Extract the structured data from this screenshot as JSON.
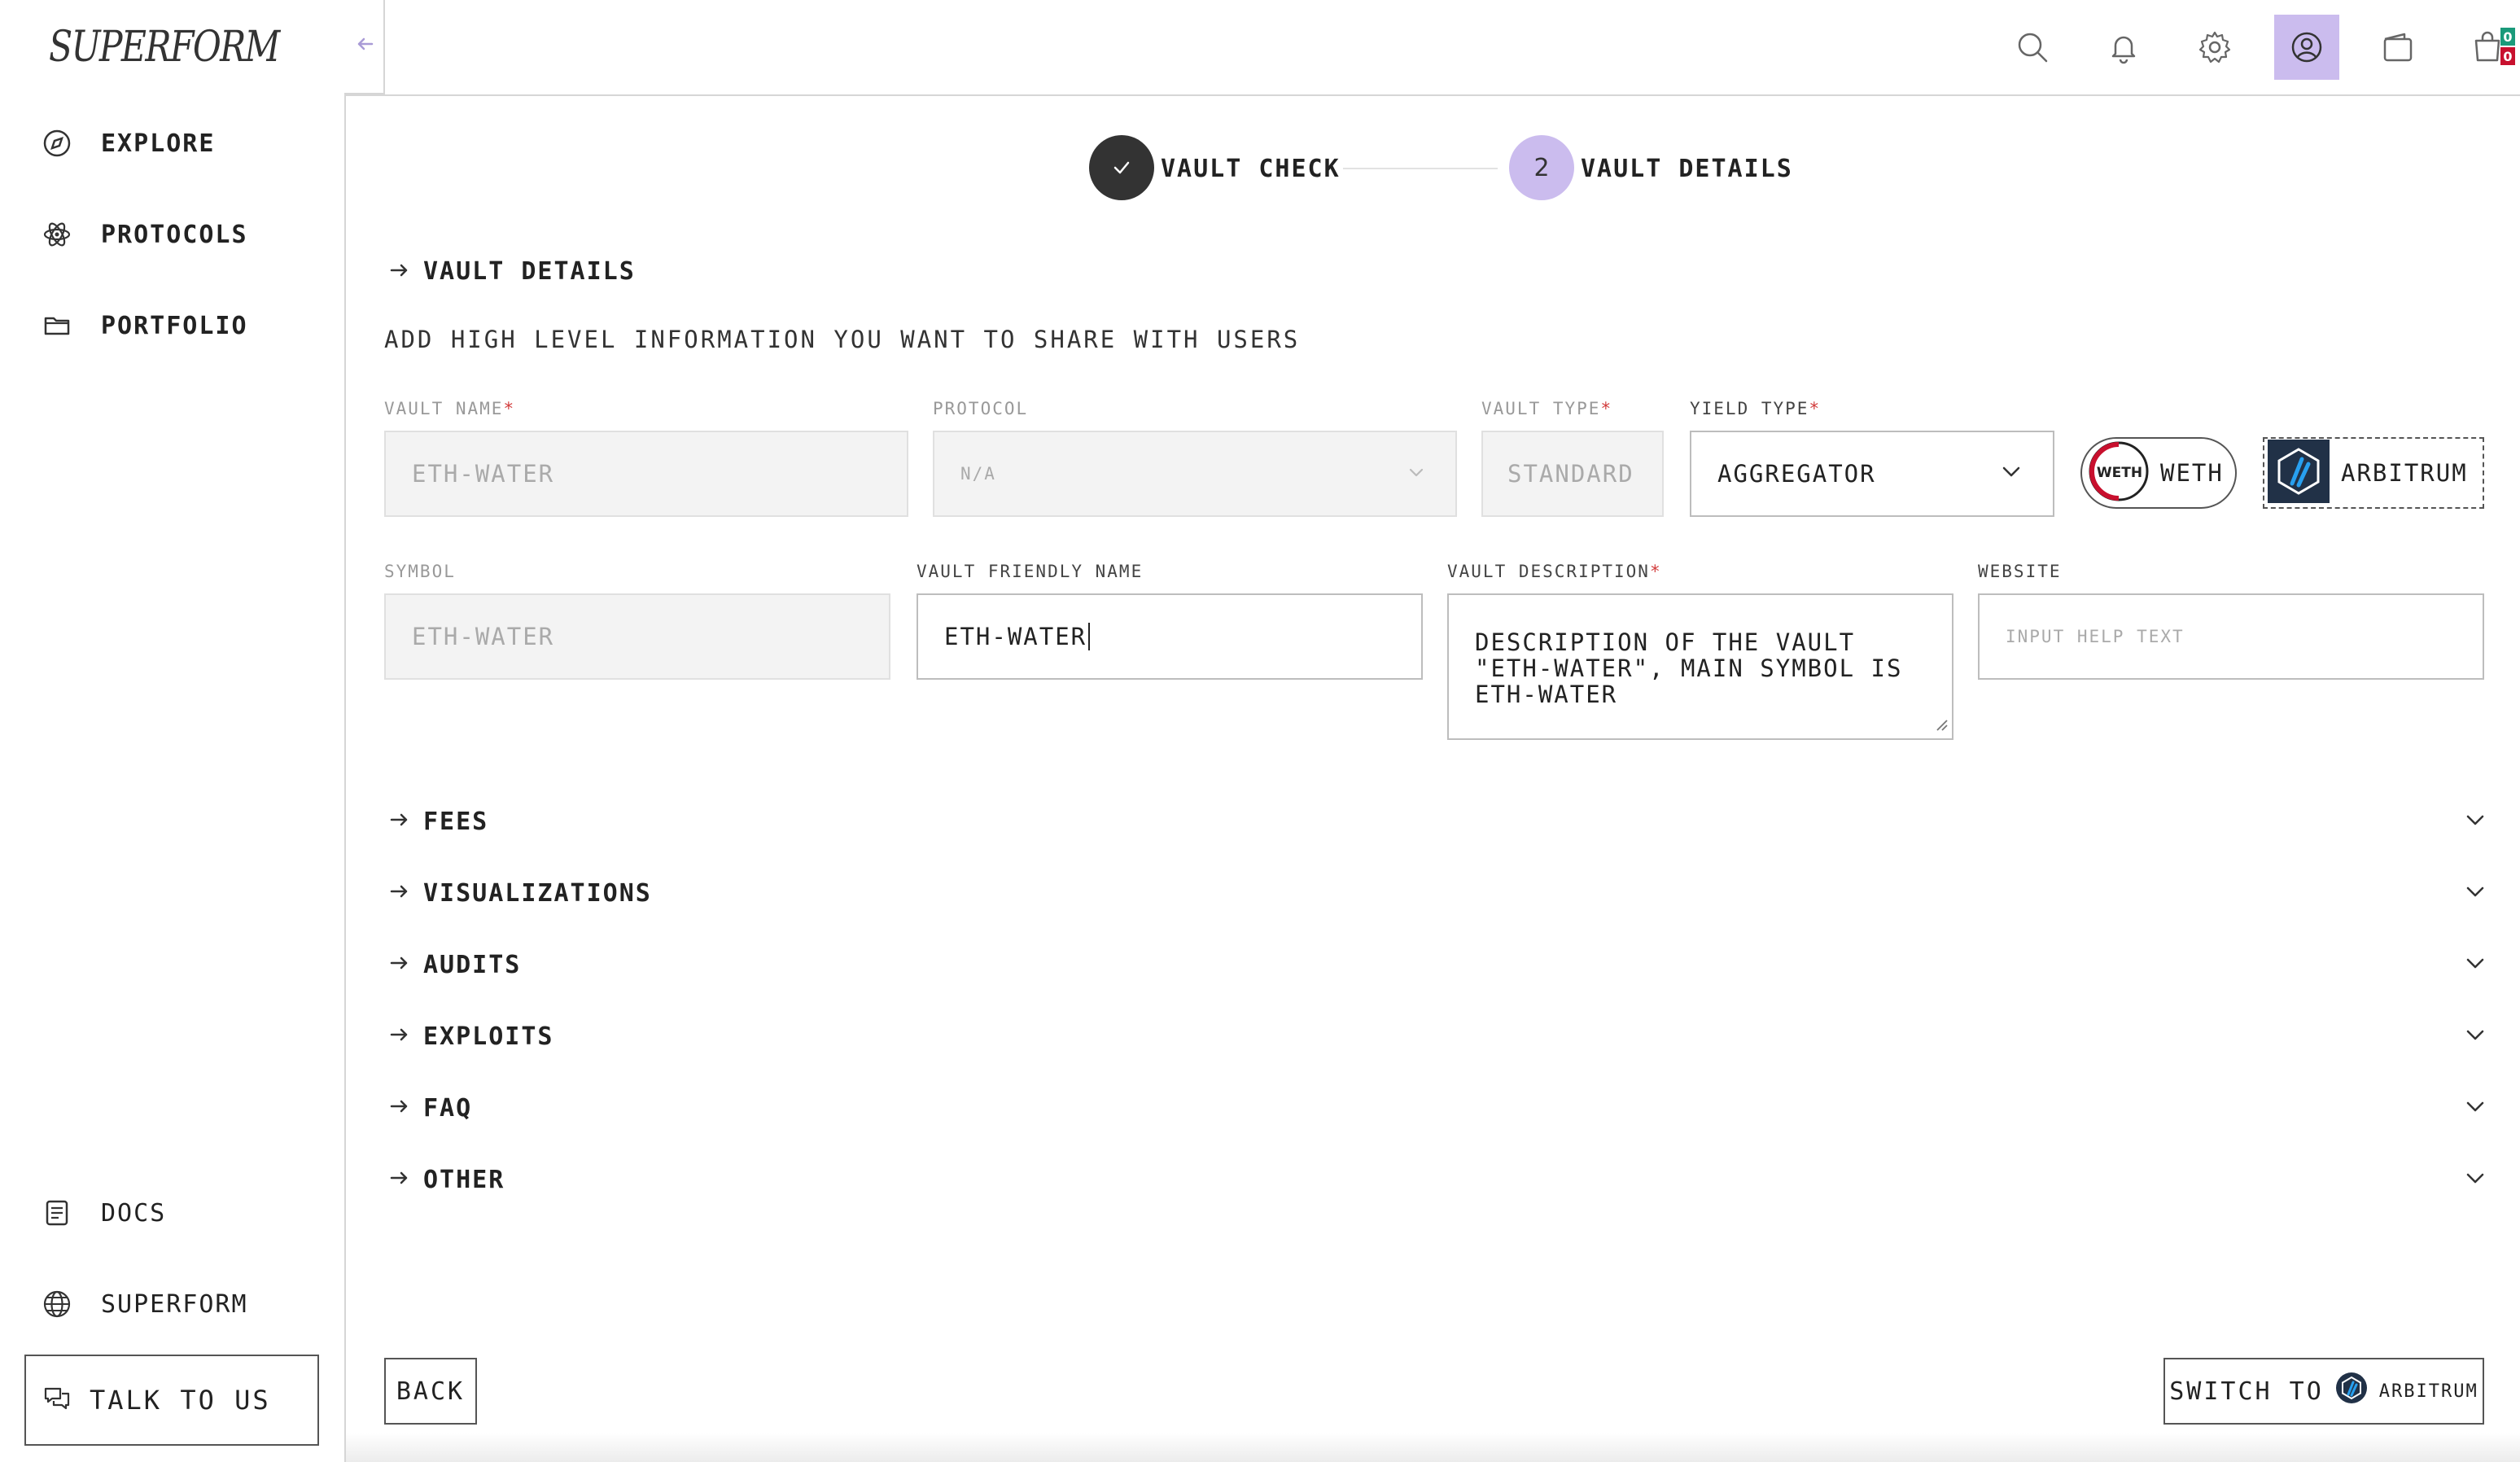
{
  "app": {
    "logo": "SUPERFORM"
  },
  "sidebar": {
    "items": [
      {
        "label": "EXPLORE",
        "icon": "compass-icon"
      },
      {
        "label": "PROTOCOLS",
        "icon": "atom-icon"
      },
      {
        "label": "PORTFOLIO",
        "icon": "folder-icon"
      }
    ],
    "bottom_items": [
      {
        "label": "DOCS",
        "icon": "document-icon"
      },
      {
        "label": "SUPERFORM",
        "icon": "globe-icon"
      }
    ],
    "talk_button": "TALK TO US"
  },
  "header": {
    "icons": [
      "search-icon",
      "bell-icon",
      "gear-icon",
      "user-icon",
      "wallet-icon",
      "cart-icon"
    ],
    "cart_badges": [
      "0",
      "0"
    ]
  },
  "stepper": {
    "steps": [
      {
        "number": "✓",
        "label": "VAULT CHECK",
        "status": "done"
      },
      {
        "number": "2",
        "label": "VAULT DETAILS",
        "status": "current"
      }
    ]
  },
  "vault_details": {
    "title": "VAULT DETAILS",
    "subtitle": "ADD HIGH LEVEL INFORMATION YOU WANT TO SHARE WITH USERS",
    "fields": {
      "vault_name": {
        "label": "VAULT NAME",
        "required": "*",
        "value": "ETH-WATER"
      },
      "protocol": {
        "label": "PROTOCOL",
        "value": "N/A"
      },
      "vault_type": {
        "label": "VAULT TYPE",
        "required": "*",
        "value": "STANDARD"
      },
      "yield_type": {
        "label": "YIELD TYPE",
        "required": "*",
        "value": "AGGREGATOR"
      },
      "symbol": {
        "label": "SYMBOL",
        "value": "ETH-WATER"
      },
      "friendly_name": {
        "label": "VAULT FRIENDLY NAME",
        "value": "ETH-WATER"
      },
      "description": {
        "label": "VAULT DESCRIPTION",
        "required": "*",
        "value": "DESCRIPTION OF THE VAULT \"ETH-WATER\", MAIN SYMBOL IS ETH-WATER"
      },
      "website": {
        "label": "WEBSITE",
        "placeholder": "INPUT HELP TEXT"
      }
    },
    "token_chip": {
      "label": "WETH",
      "logo_text": "WETH"
    },
    "network_chip": {
      "label": "ARBITRUM"
    }
  },
  "sections": [
    "FEES",
    "VISUALIZATIONS",
    "AUDITS",
    "EXPLOITS",
    "FAQ",
    "OTHER"
  ],
  "footer": {
    "back": "BACK",
    "switch_prefix": "SWITCH TO",
    "switch_network": "ARBITRUM"
  },
  "colors": {
    "accent": "#cbbcee",
    "step_done": "#333333",
    "required": "#d23b3b",
    "weth_red": "#c8102e",
    "arbitrum_dark": "#213147"
  }
}
